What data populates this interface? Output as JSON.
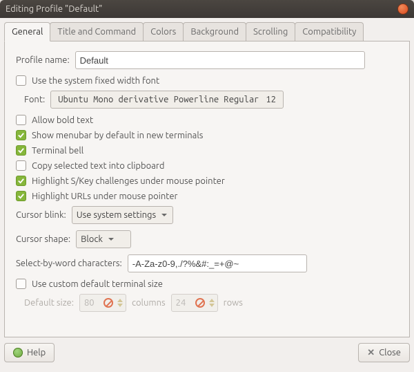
{
  "window": {
    "title": "Editing Profile \"Default\""
  },
  "tabs": [
    {
      "label": "General"
    },
    {
      "label": "Title and Command"
    },
    {
      "label": "Colors"
    },
    {
      "label": "Background"
    },
    {
      "label": "Scrolling"
    },
    {
      "label": "Compatibility"
    }
  ],
  "general": {
    "profile_name_label": "Profile name:",
    "profile_name_value": "Default",
    "use_system_font_label": "Use the system fixed width font",
    "font_label": "Font:",
    "font_name": "Ubuntu Mono derivative Powerline Regular",
    "font_size": "12",
    "allow_bold_label": "Allow bold text",
    "show_menubar_label": "Show menubar by default in new terminals",
    "terminal_bell_label": "Terminal bell",
    "copy_sel_label": "Copy selected text into clipboard",
    "highlight_skey_label": "Highlight S/Key challenges under mouse pointer",
    "highlight_urls_label": "Highlight URLs under mouse pointer",
    "cursor_blink_label": "Cursor blink:",
    "cursor_blink_value": "Use system settings",
    "cursor_shape_label": "Cursor shape:",
    "cursor_shape_value": "Block",
    "select_word_label": "Select-by-word characters:",
    "select_word_value": "-A-Za-z0-9,./?%&#:_=+@~",
    "use_custom_size_label": "Use custom default terminal size",
    "default_size_label": "Default size:",
    "default_cols": "80",
    "columns_label": "columns",
    "default_rows": "24",
    "rows_label": "rows"
  },
  "footer": {
    "help_label": "Help",
    "close_label": "Close"
  }
}
